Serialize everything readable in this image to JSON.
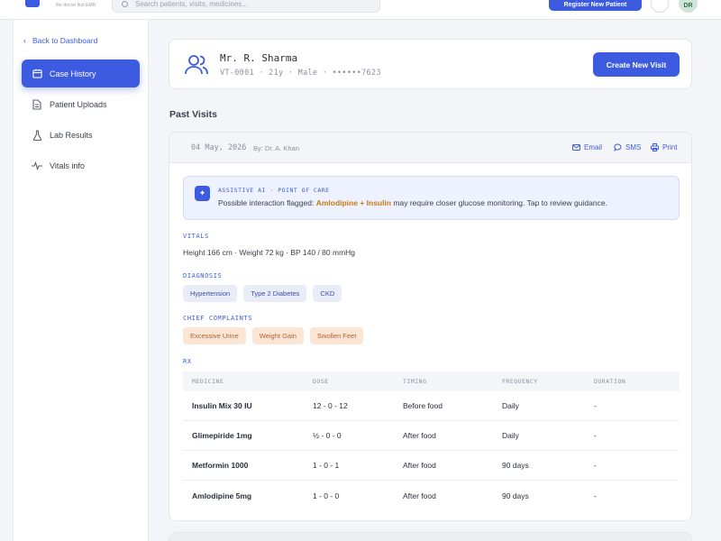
{
  "topbar": {
    "logo_sub": "the doctor first EMR",
    "search_placeholder": "Search patients, visits, medicines...",
    "register_label": "Register New Patient",
    "avatar_initials": "DR"
  },
  "sidebar": {
    "back_label": "Back to Dashboard",
    "items": [
      {
        "label": "Case History",
        "icon": "calendar-icon",
        "active": true
      },
      {
        "label": "Patient Uploads",
        "icon": "document-icon",
        "active": false
      },
      {
        "label": "Lab Results",
        "icon": "flask-icon",
        "active": false
      },
      {
        "label": "Vitals info",
        "icon": "pulse-icon",
        "active": false
      }
    ]
  },
  "patient": {
    "name": "Mr. R. Sharma",
    "meta": "VT-0001 · 21y · Male · ••••••7623",
    "new_visit_label": "Create New Visit"
  },
  "past_visits_title": "Past Visits",
  "visit": {
    "date": "04 May, 2026",
    "by": "By: Dr. A. Khan",
    "actions": {
      "email": "Email",
      "sms": "SMS",
      "print": "Print"
    },
    "ai": {
      "label": "ASSISTIVE AI · POINT OF CARE",
      "prefix": "Possible interaction flagged: ",
      "highlight": "Amlodipine + Insulin",
      "suffix": " may require closer glucose monitoring. Tap to review guidance."
    },
    "vitals_label": "VITALS",
    "vitals_text": "Height 166 cm · Weight 72 kg · BP 140 / 80 mmHg",
    "diagnosis_label": "DIAGNOSIS",
    "diagnosis": [
      "Hypertension",
      "Type 2 Diabetes",
      "CKD"
    ],
    "complaints_label": "CHIEF COMPLAINTS",
    "complaints": [
      "Excessive Urine",
      "Weight Gain",
      "Swollen Feet"
    ],
    "rx_label": "RX",
    "rx_headers": [
      "MEDICINE",
      "DOSE",
      "TIMING",
      "FREQUENCY",
      "DURATION"
    ],
    "rx_rows": [
      [
        "Insulin Mix 30 IU",
        "12 - 0 - 12",
        "Before food",
        "Daily",
        "-"
      ],
      [
        "Glimepiride 1mg",
        "½ - 0 - 0",
        "After food",
        "Daily",
        "-"
      ],
      [
        "Metformin 1000",
        "1 - 0 - 1",
        "After food",
        "90 days",
        "-"
      ],
      [
        "Amlodipine 5mg",
        "1 - 0 - 0",
        "After food",
        "90 days",
        "-"
      ]
    ]
  },
  "colors": {
    "accent": "#3d5be0",
    "warning": "#c77a15"
  }
}
